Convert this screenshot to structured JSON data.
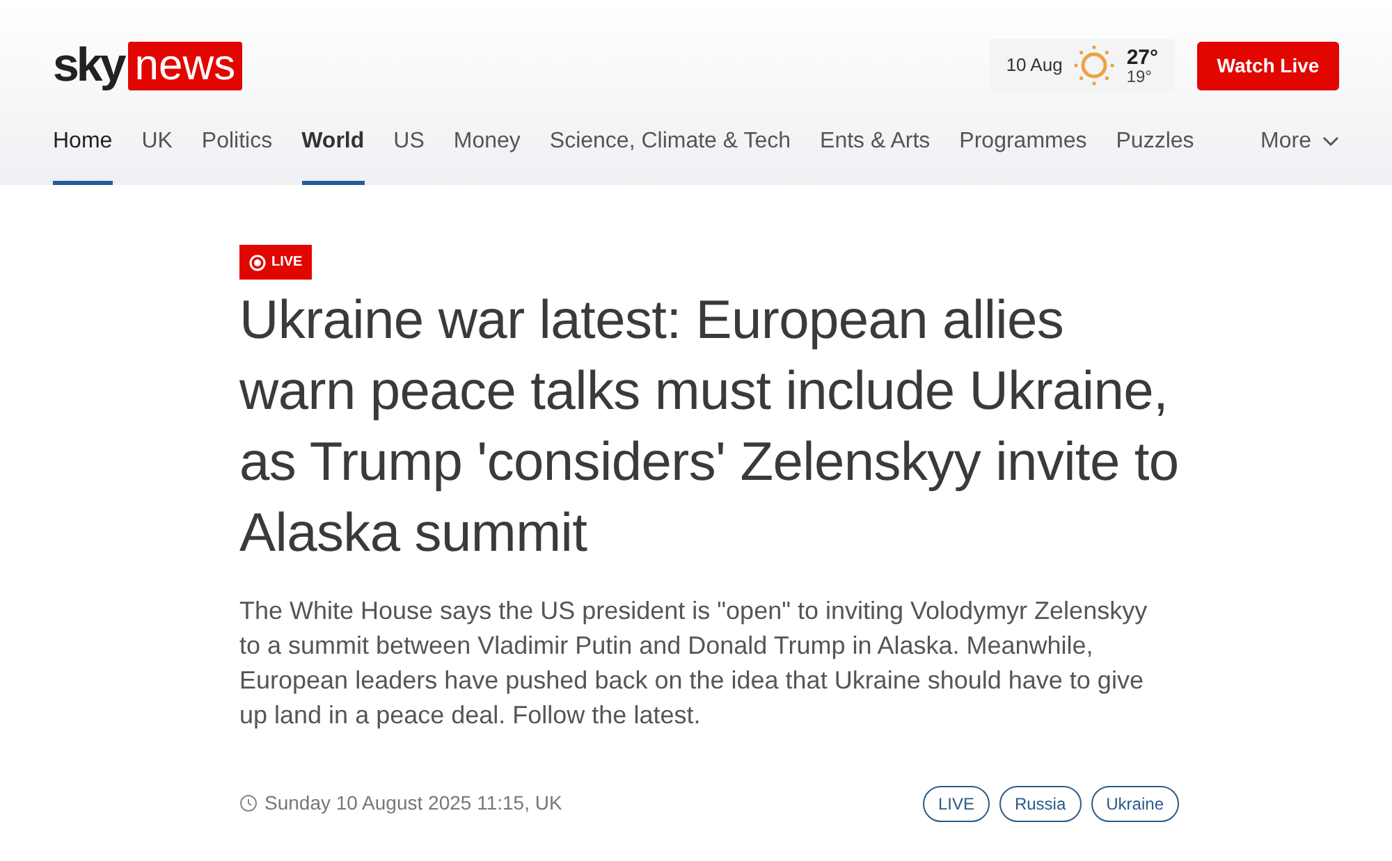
{
  "header": {
    "logo": {
      "brand": "sky",
      "name": "news"
    },
    "weather": {
      "date": "10 Aug",
      "high": "27°",
      "low": "19°"
    },
    "watch_live": "Watch Live"
  },
  "nav": {
    "items": [
      {
        "label": "Home",
        "selected": false,
        "hovered": true
      },
      {
        "label": "UK",
        "selected": false,
        "hovered": false
      },
      {
        "label": "Politics",
        "selected": false,
        "hovered": false
      },
      {
        "label": "World",
        "selected": true,
        "hovered": false
      },
      {
        "label": "US",
        "selected": false,
        "hovered": false
      },
      {
        "label": "Money",
        "selected": false,
        "hovered": false
      },
      {
        "label": "Science, Climate & Tech",
        "selected": false,
        "hovered": false
      },
      {
        "label": "Ents & Arts",
        "selected": false,
        "hovered": false
      },
      {
        "label": "Programmes",
        "selected": false,
        "hovered": false
      },
      {
        "label": "Puzzles",
        "selected": false,
        "hovered": false
      }
    ],
    "more": "More"
  },
  "article": {
    "badge": "LIVE",
    "headline": "Ukraine war latest: European allies warn peace talks must include Ukraine, as Trump 'considers' Zelenskyy invite to Alaska summit",
    "standfirst": "The White House says the US president is \"open\" to inviting Volodymyr Zelenskyy to a summit between Vladimir Putin and Donald Trump in Alaska. Meanwhile, European leaders have pushed back on the idea that Ukraine should have to give up land in a peace deal. Follow the latest.",
    "timestamp": "Sunday 10 August 2025 11:15, UK",
    "tags": [
      "LIVE",
      "Russia",
      "Ukraine"
    ]
  }
}
